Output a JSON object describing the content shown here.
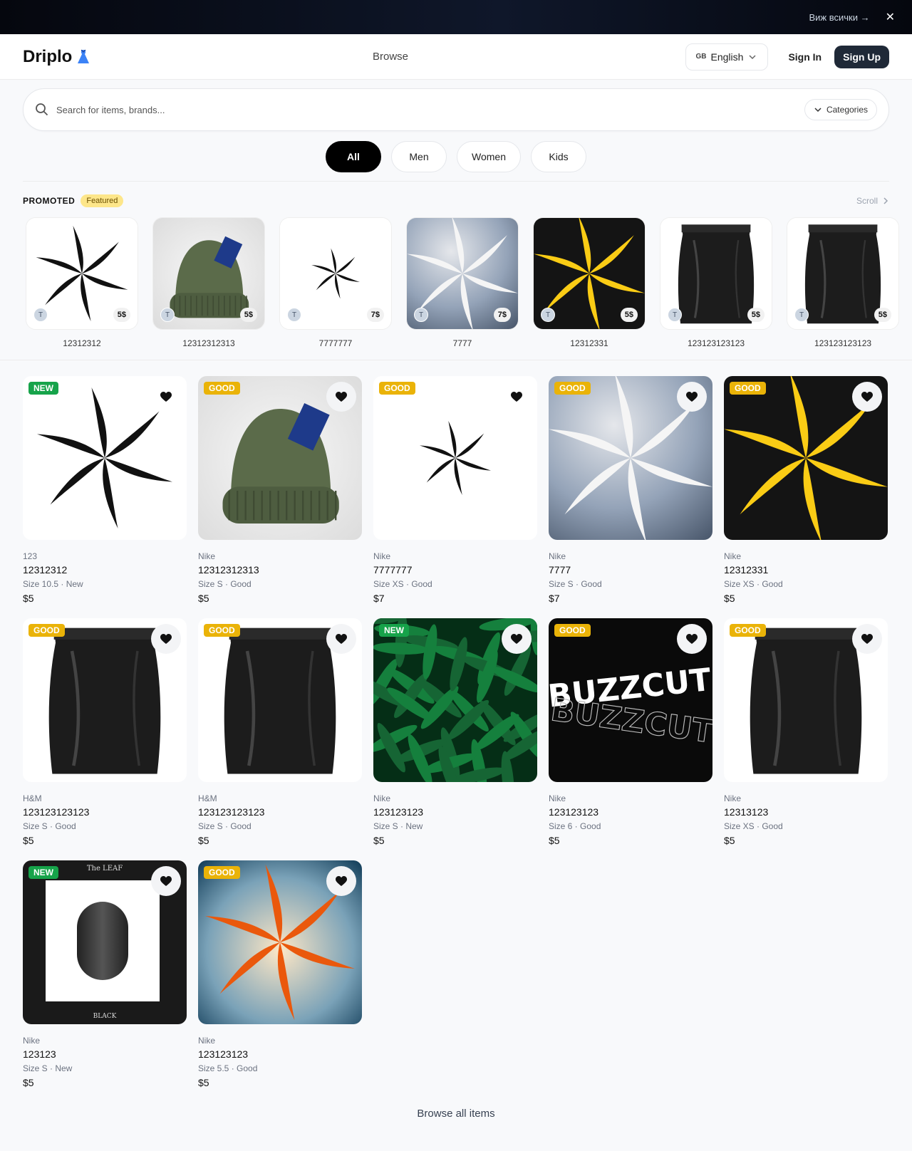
{
  "banner": {
    "link_label": "Виж всички →",
    "close_label": "✕"
  },
  "header": {
    "logo": "Driplo",
    "nav_browse": "Browse",
    "lang_flag": "GB",
    "lang_label": "English",
    "signin": "Sign In",
    "signup": "Sign Up"
  },
  "search": {
    "placeholder": "Search for items, brands...",
    "categories_label": "Categories"
  },
  "filters": [
    {
      "label": "All",
      "active": true
    },
    {
      "label": "Men"
    },
    {
      "label": "Women"
    },
    {
      "label": "Kids"
    }
  ],
  "promoted": {
    "title": "PROMOTED",
    "badge": "Featured",
    "scroll_label": "Scroll",
    "items": [
      {
        "name": "12312312",
        "price": "5$",
        "avatar": "T",
        "image": "star-black"
      },
      {
        "name": "12312312313",
        "price": "5$",
        "avatar": "T",
        "image": "beanie"
      },
      {
        "name": "7777777",
        "price": "7$",
        "avatar": "T",
        "image": "star-black-small"
      },
      {
        "name": "7777",
        "price": "7$",
        "avatar": "T",
        "image": "star-clouds"
      },
      {
        "name": "12312331",
        "price": "5$",
        "avatar": "T",
        "image": "star-yellow"
      },
      {
        "name": "123123123123",
        "price": "5$",
        "avatar": "T",
        "image": "bag"
      },
      {
        "name": "123123123123",
        "price": "5$",
        "avatar": "T",
        "image": "bag"
      }
    ]
  },
  "products": [
    {
      "condition": "NEW",
      "brand": "123",
      "title": "12312312",
      "meta": "Size 10.5 · New",
      "price": "$5",
      "image": "star-black"
    },
    {
      "condition": "GOOD",
      "brand": "Nike",
      "title": "12312312313",
      "meta": "Size S · Good",
      "price": "$5",
      "image": "beanie"
    },
    {
      "condition": "GOOD",
      "brand": "Nike",
      "title": "7777777",
      "meta": "Size XS · Good",
      "price": "$7",
      "image": "star-black-small"
    },
    {
      "condition": "GOOD",
      "brand": "Nike",
      "title": "7777",
      "meta": "Size S · Good",
      "price": "$7",
      "image": "star-clouds"
    },
    {
      "condition": "GOOD",
      "brand": "Nike",
      "title": "12312331",
      "meta": "Size XS · Good",
      "price": "$5",
      "image": "star-yellow"
    },
    {
      "condition": "GOOD",
      "brand": "H&M",
      "title": "123123123123",
      "meta": "Size S · Good",
      "price": "$5",
      "image": "bag"
    },
    {
      "condition": "GOOD",
      "brand": "H&M",
      "title": "123123123123",
      "meta": "Size S · Good",
      "price": "$5",
      "image": "bag"
    },
    {
      "condition": "NEW",
      "brand": "Nike",
      "title": "123123123",
      "meta": "Size S · New",
      "price": "$5",
      "image": "ferns"
    },
    {
      "condition": "GOOD",
      "brand": "Nike",
      "title": "123123123",
      "meta": "Size 6 · Good",
      "price": "$5",
      "image": "buzzcut",
      "image_text": "BUZZCUT"
    },
    {
      "condition": "GOOD",
      "brand": "Nike",
      "title": "12313123",
      "meta": "Size XS · Good",
      "price": "$5",
      "image": "bag"
    },
    {
      "condition": "NEW",
      "brand": "Nike",
      "title": "123123",
      "meta": "Size S · New",
      "price": "$5",
      "image": "leaf",
      "image_text_top": "The LEAF",
      "image_text_bottom": "BLACK"
    },
    {
      "condition": "GOOD",
      "brand": "Nike",
      "title": "123123123",
      "meta": "Size 5.5 · Good",
      "price": "$5",
      "image": "star-orange"
    }
  ],
  "footer": {
    "browse_all": "Browse all items"
  },
  "colors": {
    "new": "#16a34a",
    "good": "#eab308",
    "signup_bg": "#1f2937",
    "featured_bg": "#fde68a"
  }
}
